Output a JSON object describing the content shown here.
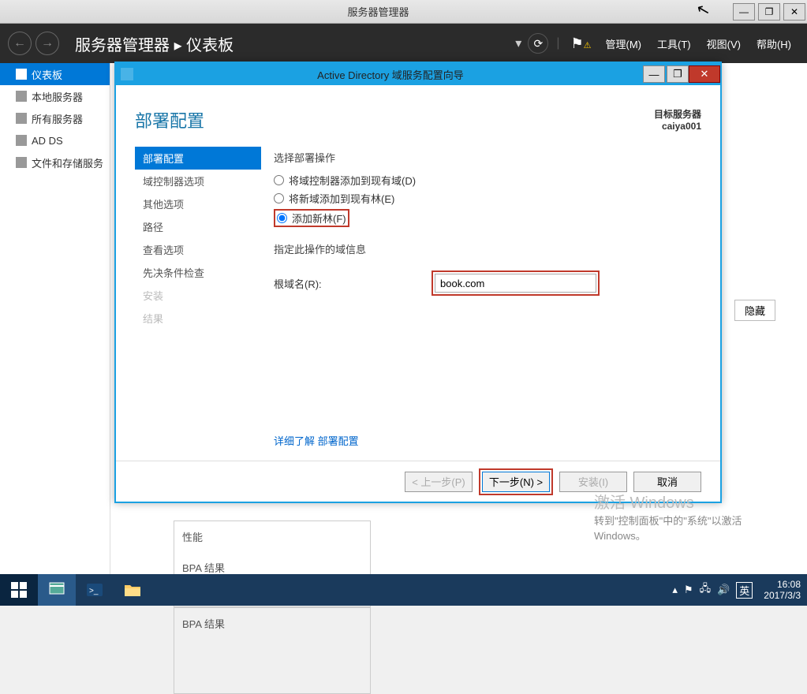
{
  "window": {
    "title": "服务器管理器",
    "minimize": "—",
    "maximize": "❐",
    "close": "✕"
  },
  "toolbar": {
    "breadcrumb_app": "服务器管理器",
    "breadcrumb_sep": "▸",
    "breadcrumb_page": "仪表板",
    "menu_manage": "管理(M)",
    "menu_tools": "工具(T)",
    "menu_view": "视图(V)",
    "menu_help": "帮助(H)"
  },
  "sidebar": {
    "items": [
      {
        "label": "仪表板"
      },
      {
        "label": "本地服务器"
      },
      {
        "label": "所有服务器"
      },
      {
        "label": "AD DS"
      },
      {
        "label": "文件和存储服务"
      }
    ]
  },
  "bg": {
    "hidden": "隐藏",
    "box1_line1": "性能",
    "box1_line2": "BPA 结果",
    "box2_line1": "BPA 结果"
  },
  "wizard": {
    "title": "Active Directory 域服务配置向导",
    "heading": "部署配置",
    "target_label": "目标服务器",
    "target_value": "caiya001",
    "steps": [
      "部署配置",
      "域控制器选项",
      "其他选项",
      "路径",
      "查看选项",
      "先决条件检查",
      "安装",
      "结果"
    ],
    "section1": "选择部署操作",
    "radio1": "将域控制器添加到现有域(D)",
    "radio2": "将新域添加到现有林(E)",
    "radio3": "添加新林(F)",
    "section2": "指定此操作的域信息",
    "field_label": "根域名(R):",
    "field_value": "book.com",
    "learn_more": "详细了解 部署配置",
    "btn_prev": "< 上一步(P)",
    "btn_next": "下一步(N) >",
    "btn_install": "安装(I)",
    "btn_cancel": "取消"
  },
  "watermark": {
    "title": "激活 Windows",
    "detail": "转到\"控制面板\"中的\"系统\"以激活 Windows。"
  },
  "taskbar": {
    "ime": "英",
    "time": "16:08",
    "date": "2017/3/3"
  }
}
